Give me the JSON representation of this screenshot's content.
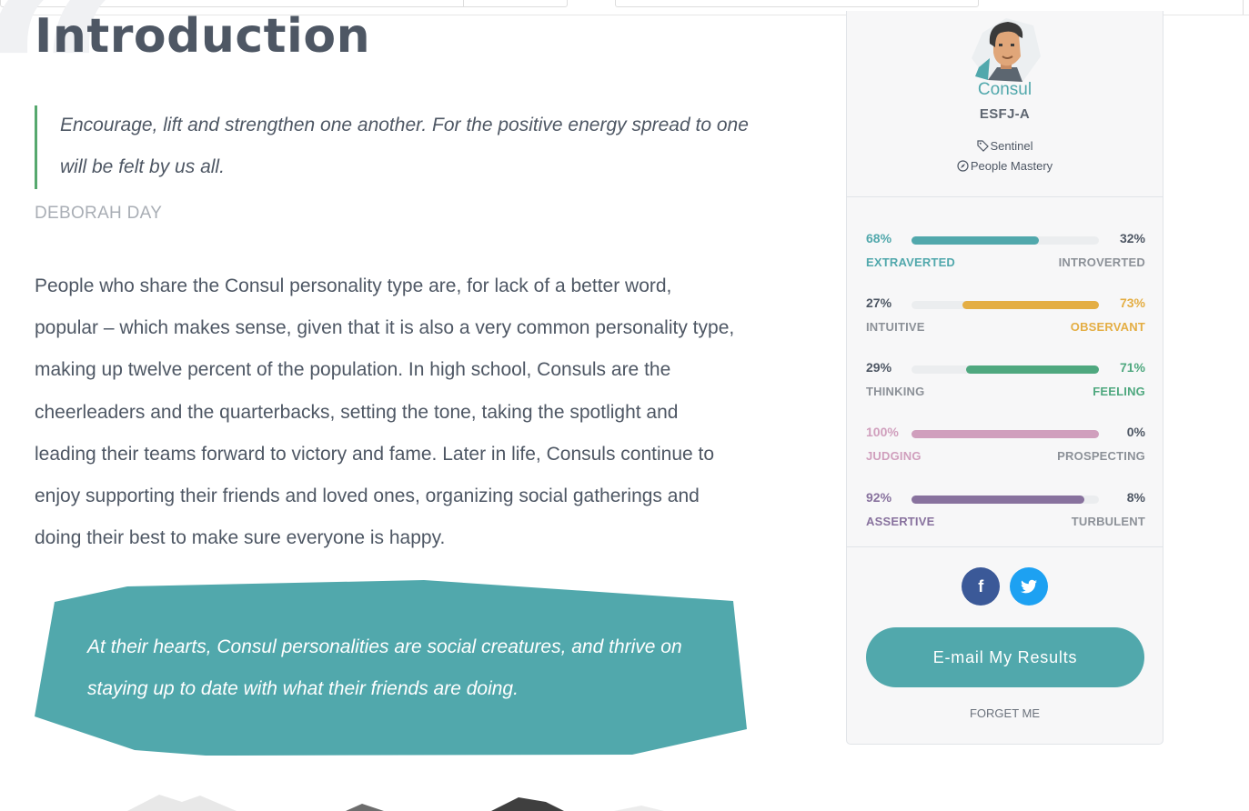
{
  "article": {
    "title": "Introduction",
    "big_quote_glyph": "“",
    "quote": {
      "text": "Encourage, lift and strengthen one another. For the positive energy spread to one will be felt by us all.",
      "author": "DEBORAH DAY"
    },
    "body": "People who share the Consul personality type are, for lack of a better word, popular – which makes sense, given that it is also a very common personality type, making up twelve percent of the population. In high school, Consuls are the cheerleaders and the quarterbacks, setting the tone, taking the spotlight and leading their teams forward to victory and fame. Later in life, Consuls continue to enjoy supporting their friends and loved ones, organizing social gatherings and doing their best to make sure everyone is happy.",
    "callout": "At their hearts, Consul personalities are social creatures, and thrive on staying up to date with what their friends are doing.",
    "callout_color": "#51a8ac"
  },
  "profile": {
    "type_name": "Consul",
    "type_code": "ESFJ-A",
    "role": "Sentinel",
    "strategy": "People Mastery",
    "avatar_icon": "consul-avatar-icon",
    "traits": [
      {
        "left_pct": "68%",
        "right_pct": "32%",
        "left_label": "EXTRAVERTED",
        "right_label": "INTROVERTED",
        "value": 68,
        "dominant": "left",
        "color": "#51a8ac"
      },
      {
        "left_pct": "27%",
        "right_pct": "73%",
        "left_label": "INTUITIVE",
        "right_label": "OBSERVANT",
        "value": 73,
        "dominant": "right",
        "color": "#e4ae44"
      },
      {
        "left_pct": "29%",
        "right_pct": "71%",
        "left_label": "THINKING",
        "right_label": "FEELING",
        "value": 71,
        "dominant": "right",
        "color": "#4fa87f"
      },
      {
        "left_pct": "100%",
        "right_pct": "0%",
        "left_label": "JUDGING",
        "right_label": "PROSPECTING",
        "value": 100,
        "dominant": "left",
        "color": "#d09fbd"
      },
      {
        "left_pct": "92%",
        "right_pct": "8%",
        "left_label": "ASSERTIVE",
        "right_label": "TURBULENT",
        "value": 92,
        "dominant": "left",
        "color": "#88729e"
      }
    ],
    "social": {
      "facebook_glyph": "f",
      "facebook_color": "#3b5998",
      "twitter_color": "#1da1f2"
    },
    "email_button": "E-mail My Results",
    "forget_link": "FORGET ME"
  }
}
